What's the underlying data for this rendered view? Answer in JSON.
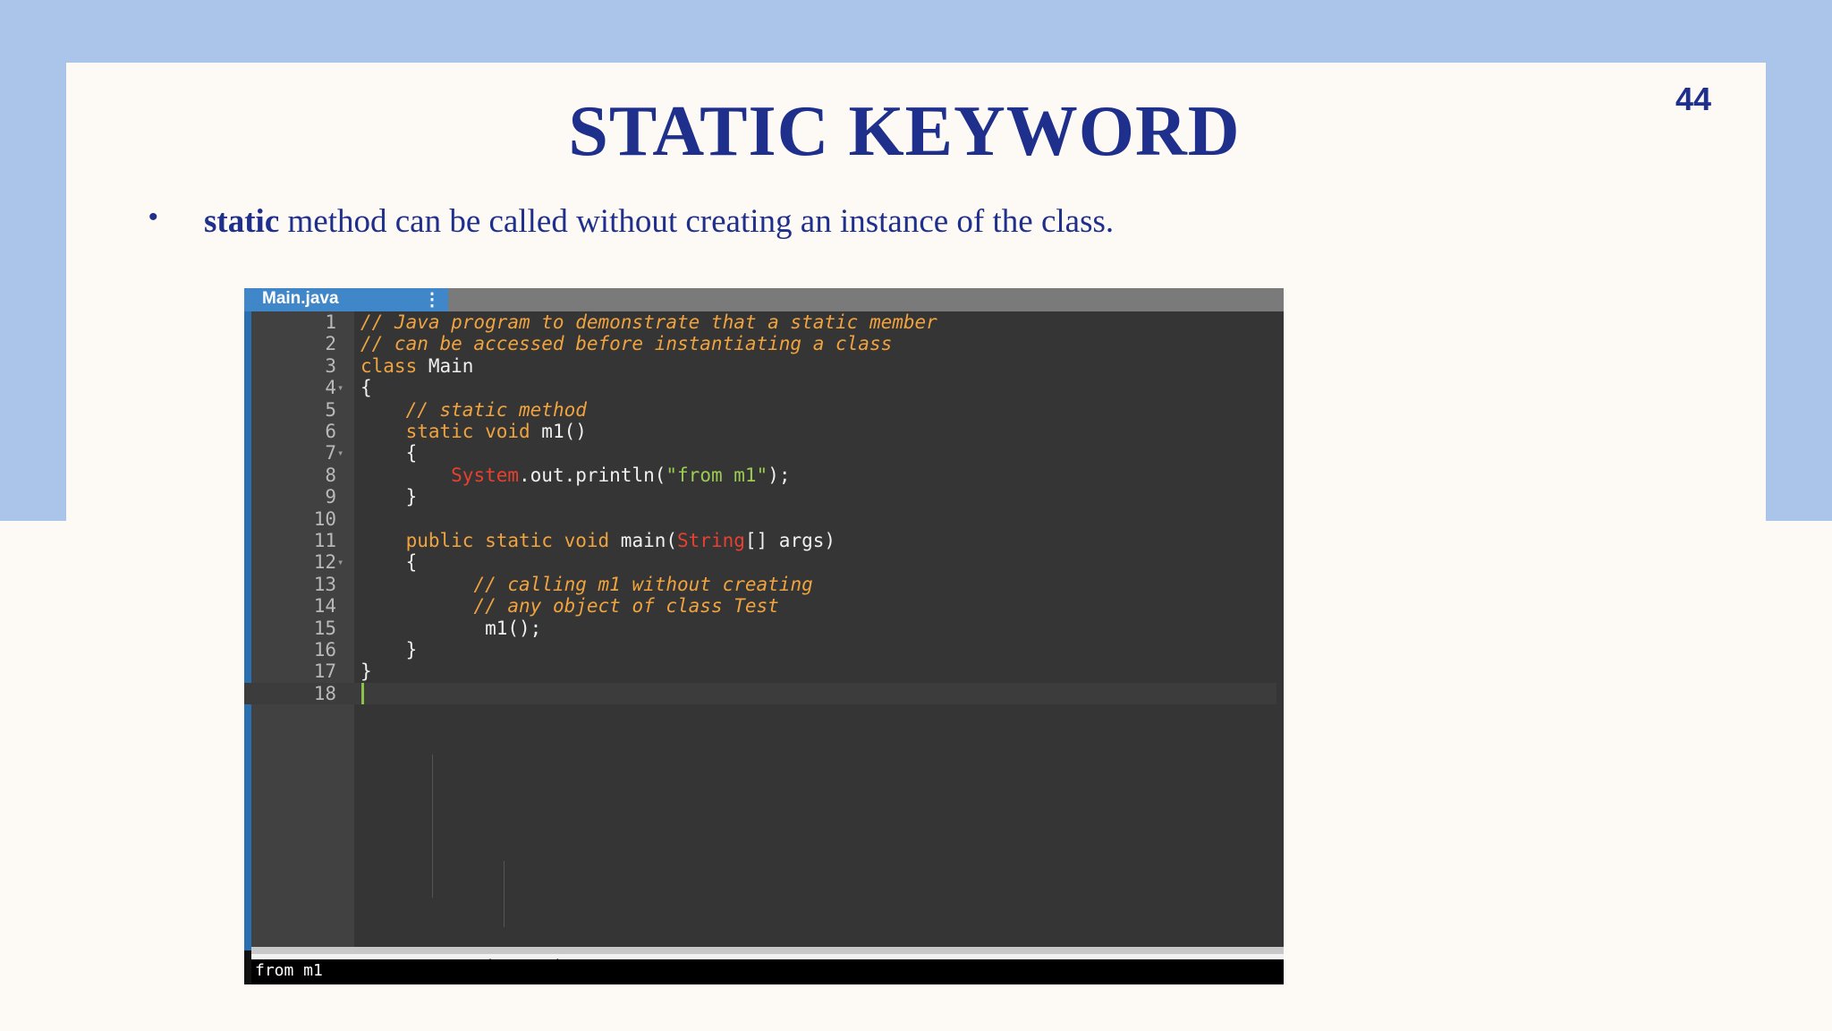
{
  "slide": {
    "page_number": "44",
    "title": "STATIC KEYWORD",
    "bullet": {
      "keyword": "static",
      "text": " method can be called without creating an instance of the class."
    }
  },
  "editor": {
    "tab_label": "Main.java",
    "tab_menu_icon": "kebab-menu-icon",
    "lines": [
      {
        "n": "1",
        "fold": ""
      },
      {
        "n": "2",
        "fold": ""
      },
      {
        "n": "3",
        "fold": ""
      },
      {
        "n": "4",
        "fold": "▾"
      },
      {
        "n": "5",
        "fold": ""
      },
      {
        "n": "6",
        "fold": ""
      },
      {
        "n": "7",
        "fold": "▾"
      },
      {
        "n": "8",
        "fold": ""
      },
      {
        "n": "9",
        "fold": ""
      },
      {
        "n": "10",
        "fold": ""
      },
      {
        "n": "11",
        "fold": ""
      },
      {
        "n": "12",
        "fold": "▾"
      },
      {
        "n": "13",
        "fold": ""
      },
      {
        "n": "14",
        "fold": ""
      },
      {
        "n": "15",
        "fold": ""
      },
      {
        "n": "16",
        "fold": ""
      },
      {
        "n": "17",
        "fold": ""
      },
      {
        "n": "18",
        "fold": ""
      }
    ],
    "code": {
      "l1": "// Java program to demonstrate that a static member",
      "l2": "// can be accessed before instantiating a class",
      "l3_kw": "class",
      "l3_rest": " Main",
      "l4": "{",
      "l5": "// static method",
      "l6_kw": "static void",
      "l6_rest": " m1()",
      "l7": "{",
      "l8_sys": "System",
      "l8_mid": ".out.println(",
      "l8_str": "\"from m1\"",
      "l8_end": ");",
      "l9": "}",
      "l11_kw": "public static void",
      "l11_mid": " main(",
      "l11_type": "String",
      "l11_end": "[] args)",
      "l12": "{",
      "l13": "// calling m1 without creating",
      "l14": "// any object of class Test",
      "l15": "m1();",
      "l16": "}",
      "l17": "}"
    },
    "toolbar_icons": [
      "chevron-down-icon",
      "expand-icon",
      "layout-icon",
      "gear-icon",
      "share-icon"
    ],
    "console_output": "from m1"
  }
}
